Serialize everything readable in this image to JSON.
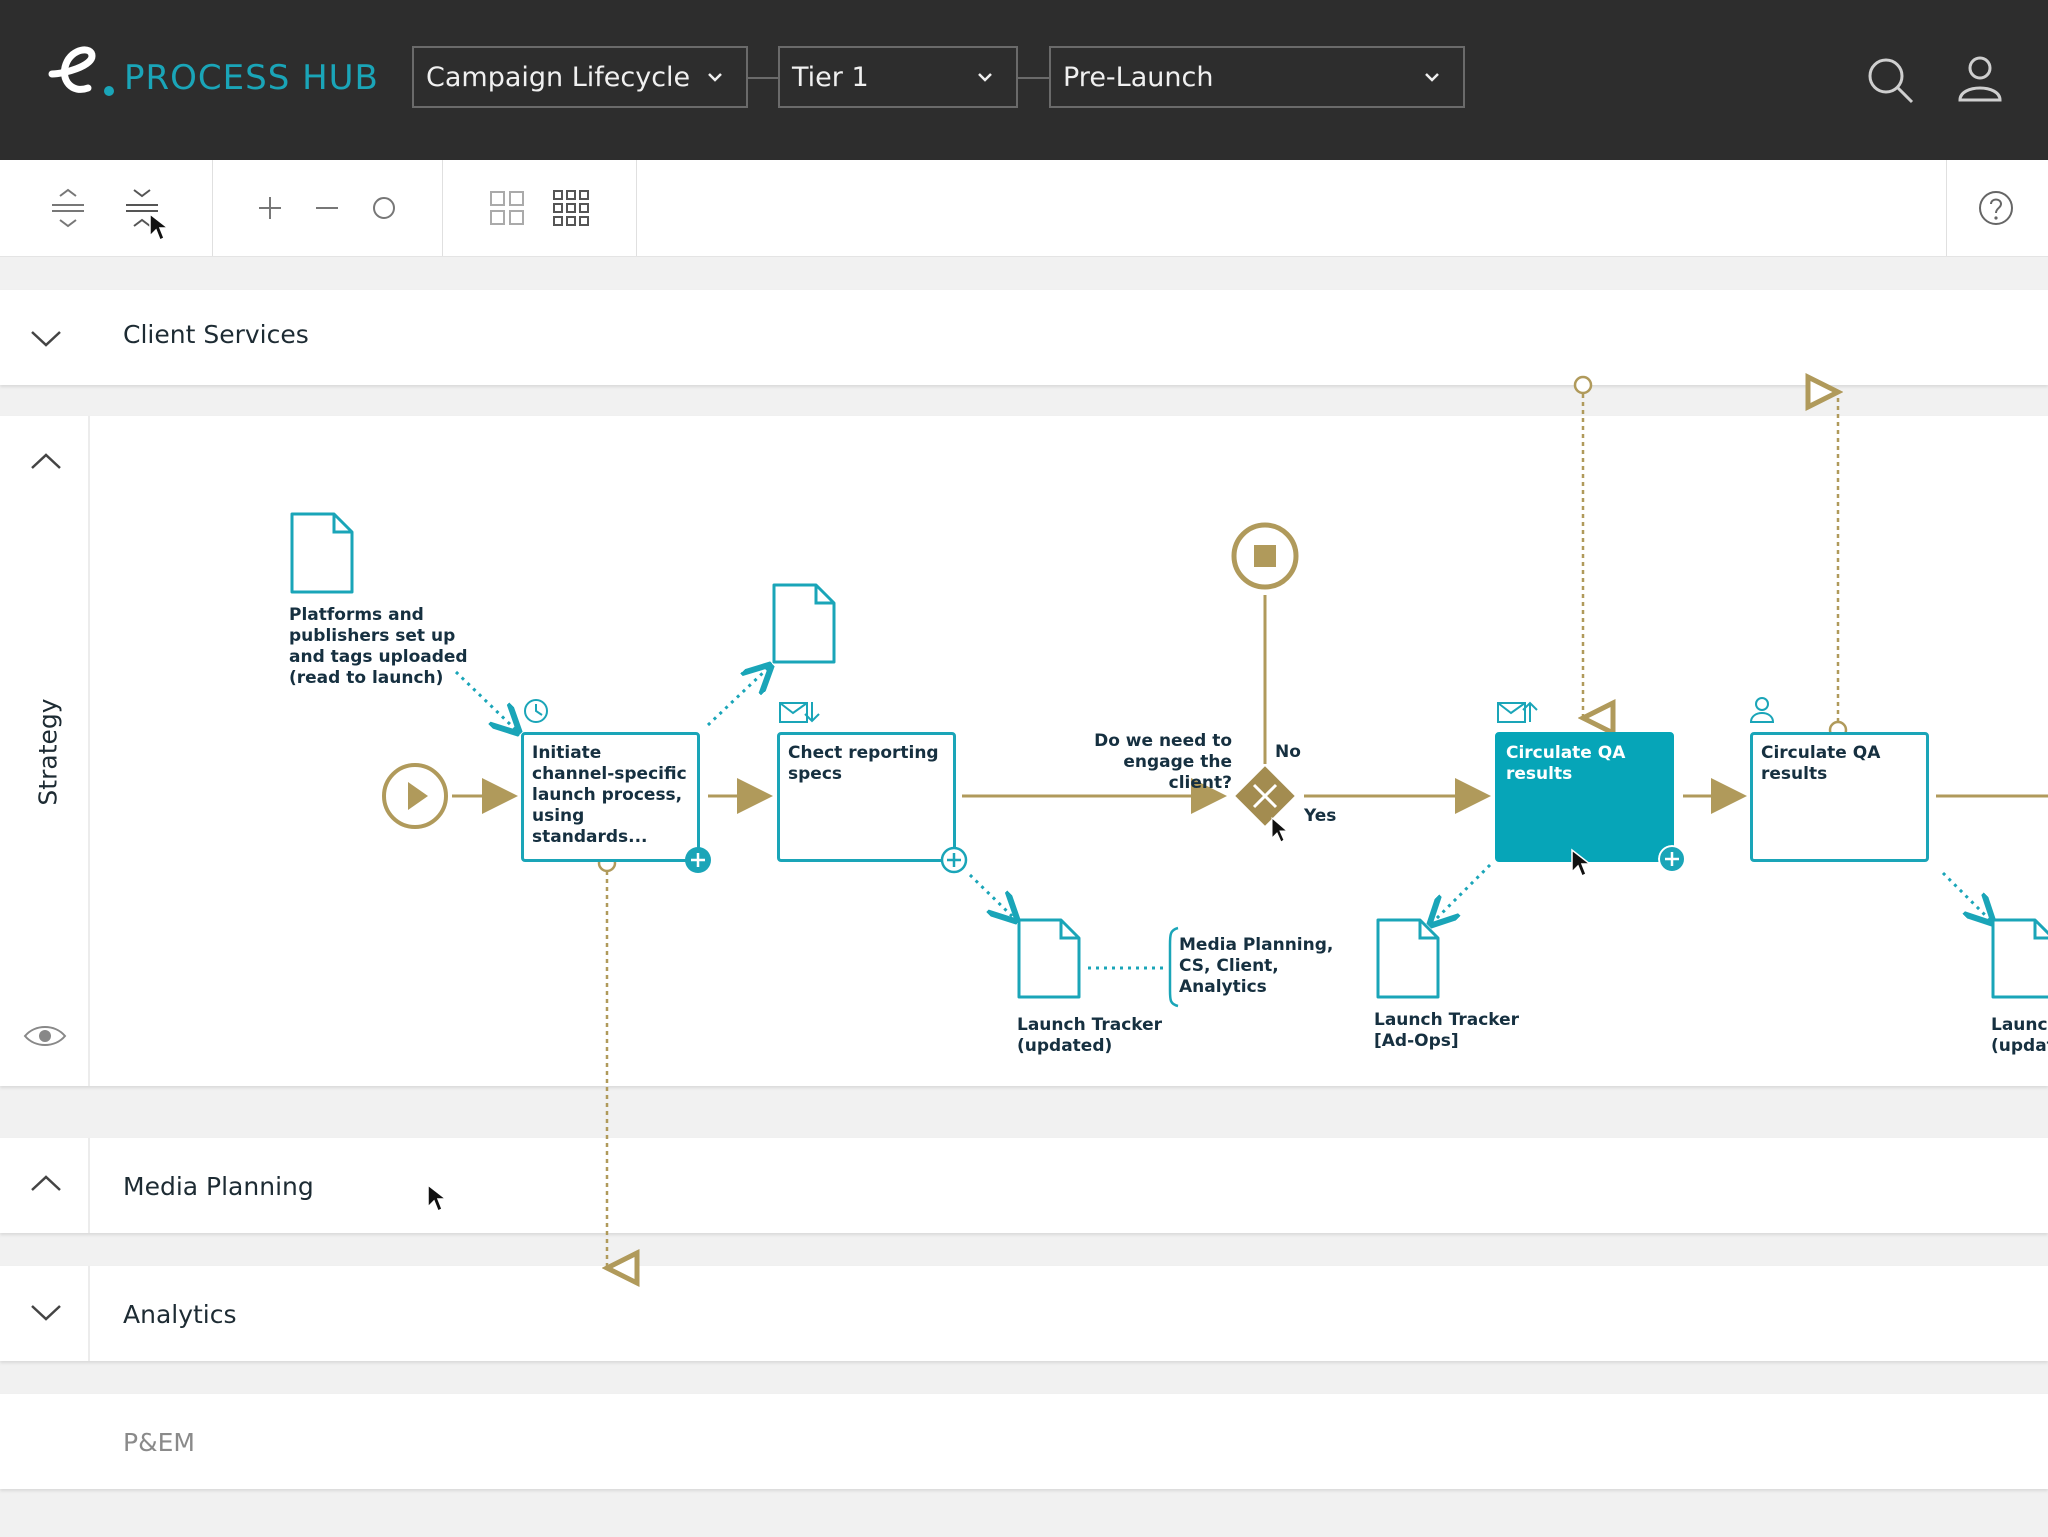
{
  "app": {
    "logo_text": "PROCESS HUB",
    "brand_color": "#1aa5b8",
    "topbar_color": "#2d2d2d"
  },
  "filters": {
    "process": "Campaign Lifecycle",
    "tier": "Tier 1",
    "stage": "Pre-Launch"
  },
  "toolbar": {
    "icons": [
      "expand-all-icon",
      "collapse-all-icon",
      "zoom-in-icon",
      "zoom-out-icon",
      "reset-zoom-icon",
      "grid-small-icon",
      "grid-large-icon",
      "help-icon"
    ]
  },
  "lanes": {
    "client_services": "Client Services",
    "strategy": "Strategy",
    "media_planning": "Media Planning",
    "analytics": "Analytics",
    "pem": "P&EM"
  },
  "diagram": {
    "doc_platforms": [
      "Platforms and",
      "publishers set up",
      "and tags uploaded",
      "(read to launch)"
    ],
    "task_initiate": "Initiate channel-specific launch process, using standards...",
    "task_check": "Chect reporting specs",
    "gateway_question": [
      "Do we need to",
      "engage the client?"
    ],
    "gateway_no": "No",
    "gateway_yes": "Yes",
    "task_circulate_1": "Circulate QA results",
    "task_circulate_2": "Circulate QA results",
    "doc_launch_tracker_updated": [
      "Launch Tracker",
      "(updated)"
    ],
    "annotation_roles": [
      "Media Planning,",
      "CS, Client,",
      "Analytics"
    ],
    "doc_launch_tracker_adops": [
      "Launch Tracker",
      "[Ad-Ops]"
    ],
    "doc_launch_partial": [
      "Launch",
      "(updat"
    ]
  },
  "colors": {
    "teal": "#1aa5b8",
    "gold": "#b09a5b",
    "active_task": "#06a5b8"
  }
}
